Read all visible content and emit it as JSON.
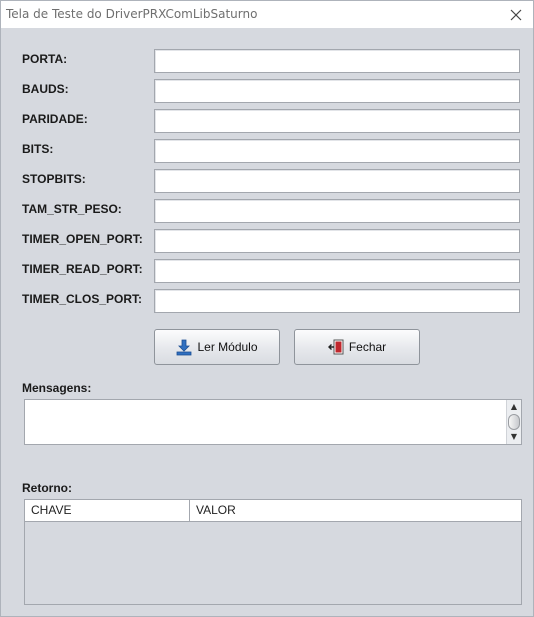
{
  "window": {
    "title": "Tela de Teste do DriverPRXComLibSaturno"
  },
  "form": {
    "fields": [
      {
        "label": "PORTA:",
        "value": ""
      },
      {
        "label": "BAUDS:",
        "value": ""
      },
      {
        "label": "PARIDADE:",
        "value": ""
      },
      {
        "label": "BITS:",
        "value": ""
      },
      {
        "label": "STOPBITS:",
        "value": ""
      },
      {
        "label": "TAM_STR_PESO:",
        "value": ""
      },
      {
        "label": "TIMER_OPEN_PORT:",
        "value": ""
      },
      {
        "label": "TIMER_READ_PORT:",
        "value": ""
      },
      {
        "label": "TIMER_CLOS_PORT:",
        "value": ""
      }
    ]
  },
  "buttons": {
    "read_module": "Ler Módulo",
    "close": "Fechar"
  },
  "messages": {
    "label": "Mensagens:",
    "value": ""
  },
  "result": {
    "label": "Retorno:",
    "columns": [
      "CHAVE",
      "VALOR"
    ]
  },
  "icons": {
    "close": "close-icon",
    "download": "download-icon",
    "exit": "exit-door-icon"
  },
  "colors": {
    "window_bg": "#d6d9df",
    "download_icon": "#2f6fc0",
    "exit_icon": "#c0272d"
  }
}
